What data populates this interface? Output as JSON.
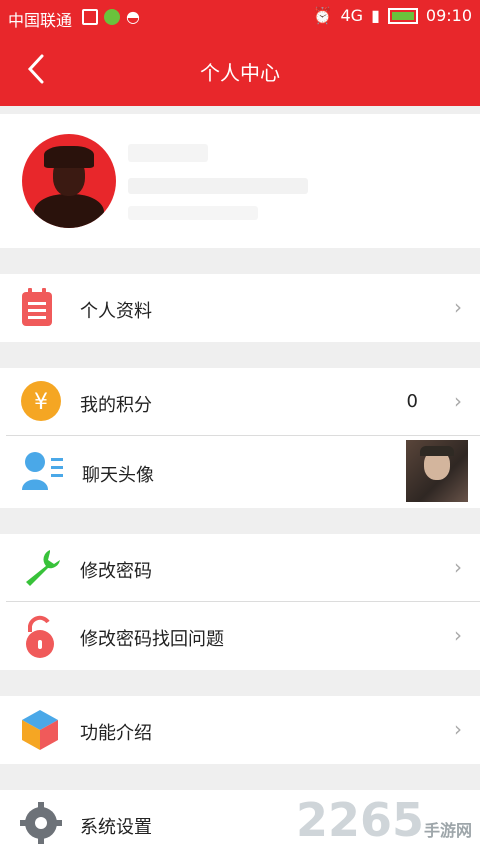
{
  "status": {
    "carrier": "中国联通",
    "time": "09:10",
    "network": "4G"
  },
  "header": {
    "title": "个人中心"
  },
  "menu": {
    "profile": "个人资料",
    "points": "我的积分",
    "points_value": "0",
    "chat_avatar": "聊天头像",
    "change_password": "修改密码",
    "recover_question": "修改密码找回问题",
    "intro": "功能介绍",
    "settings": "系统设置"
  },
  "chevron": "›",
  "watermark": {
    "main": "2265",
    "sub": "手游网"
  },
  "colors": {
    "primary": "#e8272b",
    "orange": "#f5a623",
    "blue": "#4aa8e8",
    "green": "#38c23a",
    "gray": "#6d7278"
  }
}
